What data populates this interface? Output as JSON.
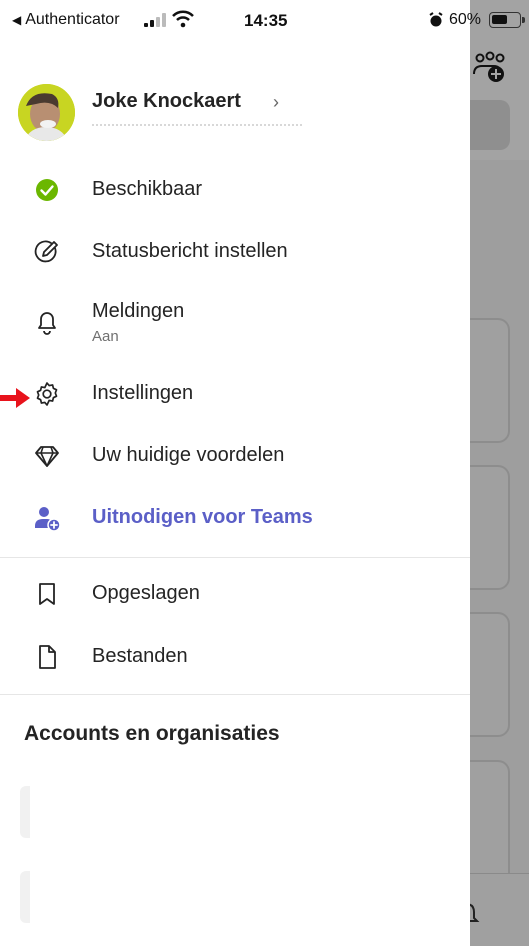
{
  "statusbar": {
    "back_app": "Authenticator",
    "time": "14:35",
    "battery": "60%",
    "battery_level": 0.6
  },
  "profile": {
    "name": "Joke Knockaert"
  },
  "menu": {
    "status": "Beschikbaar",
    "status_message": "Statusbericht instellen",
    "notifications": "Meldingen",
    "notifications_sub": "Aan",
    "settings": "Instellingen",
    "benefits": "Uw huidige voordelen",
    "invite": "Uitnodigen voor Teams",
    "saved": "Opgeslagen",
    "files": "Bestanden"
  },
  "accounts": {
    "title": "Accounts en organisaties"
  },
  "colors": {
    "accent": "#5b5fc7",
    "available": "#6bb700",
    "pointer": "#e8131c"
  }
}
